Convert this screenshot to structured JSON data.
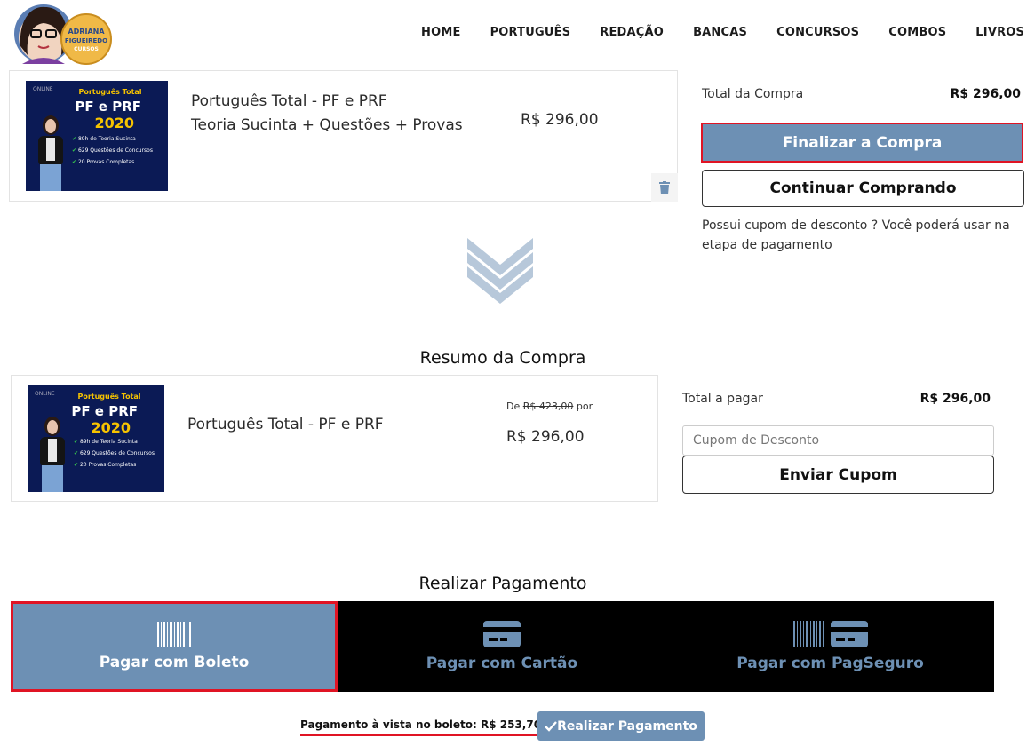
{
  "header": {
    "logo_text": [
      "ADRIANA",
      "FIGUEIREDO",
      "CURSOS"
    ],
    "nav": [
      "HOME",
      "PORTUGUÊS",
      "REDAÇÃO",
      "BANCAS",
      "CONCURSOS",
      "COMBOS",
      "LIVROS"
    ]
  },
  "cart": {
    "item": {
      "title_line1": "Português Total - PF e PRF",
      "title_line2": "Teoria Sucinta + Questões + Provas",
      "price": "R$ 296,00",
      "thumb": {
        "badge": "ONLINE",
        "line1": "Português Total",
        "line2": "PF e PRF",
        "line3": "2020",
        "bullets": [
          "89h de Teoria Sucinta",
          "629 Questões de Concursos",
          "20 Provas Completas"
        ]
      }
    },
    "delete_icon": "trash-icon"
  },
  "summary_box": {
    "total_label": "Total da Compra",
    "total_value": "R$ 296,00",
    "finalize_label": "Finalizar a Compra",
    "continue_label": "Continuar Comprando",
    "coupon_note": "Possui cupom de desconto ? Você poderá usar na etapa de pagamento"
  },
  "resumo": {
    "heading": "Resumo da Compra",
    "item": {
      "title": "Português Total - PF e PRF",
      "from_prefix": "De",
      "old_price": "R$ 423,00",
      "from_suffix": "por",
      "price": "R$ 296,00"
    },
    "total_label": "Total a pagar",
    "total_value": "R$ 296,00",
    "coupon_placeholder": "Cupom de Desconto",
    "send_coupon_label": "Enviar Cupom"
  },
  "payment": {
    "heading": "Realizar Pagamento",
    "tabs": [
      {
        "label": "Pagar com Boleto",
        "icon": "barcode-icon",
        "active": true
      },
      {
        "label": "Pagar com Cartão",
        "icon": "credit-card-icon",
        "active": false
      },
      {
        "label": "Pagar com PagSeguro",
        "icon": "barcode-card-icon",
        "active": false
      }
    ],
    "boleto_note": "Pagamento à vista no boleto: R$ 253,70",
    "pay_button_label": "Realizar Pagamento",
    "pay_button_icon": "check-icon"
  },
  "colors": {
    "accent": "#6d90b4",
    "highlight_border": "#e01424",
    "chevron": "#b7c8da"
  }
}
